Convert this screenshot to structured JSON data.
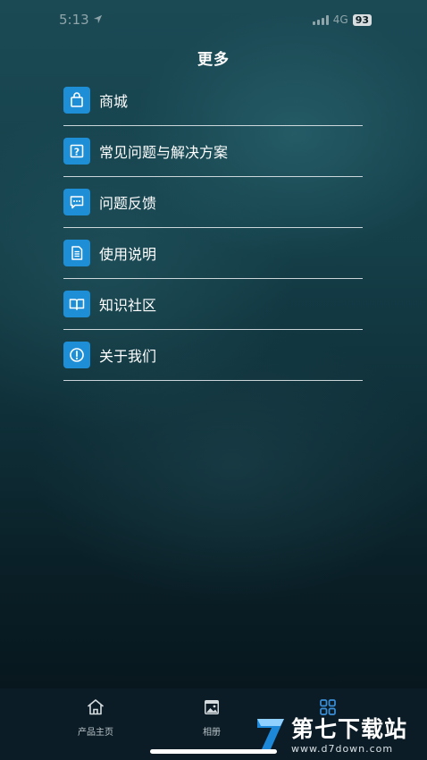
{
  "status_bar": {
    "time": "5:13",
    "network": "4G",
    "battery": "93"
  },
  "header": {
    "title": "更多"
  },
  "menu": {
    "items": [
      {
        "label": "商城",
        "icon": "shopping-bag-icon"
      },
      {
        "label": "常见问题与解决方案",
        "icon": "question-icon"
      },
      {
        "label": "问题反馈",
        "icon": "chat-icon"
      },
      {
        "label": "使用说明",
        "icon": "document-icon"
      },
      {
        "label": "知识社区",
        "icon": "book-icon"
      },
      {
        "label": "关于我们",
        "icon": "info-icon"
      }
    ]
  },
  "tab_bar": {
    "tabs": [
      {
        "label": "产品主页",
        "icon": "home-icon"
      },
      {
        "label": "相册",
        "icon": "photo-icon"
      },
      {
        "label": "",
        "icon": "grid-icon"
      }
    ]
  },
  "watermark": {
    "title": "第七下载站",
    "url": "www.d7down.com"
  },
  "colors": {
    "accent": "#1e8fd6",
    "tab_active": "#3a8fd8",
    "tab_bar_bg": "#0c1c26"
  }
}
